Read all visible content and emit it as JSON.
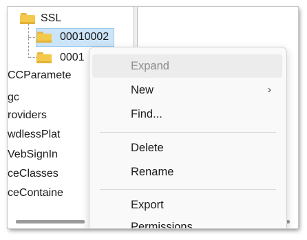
{
  "tree": {
    "items": [
      {
        "label": "SSL"
      },
      {
        "label": "00010002"
      },
      {
        "label": "0001"
      },
      {
        "label": "CCParamete"
      },
      {
        "label": "gc"
      },
      {
        "label": "roviders"
      },
      {
        "label": "wdlessPlat"
      },
      {
        "label": "VebSignIn"
      },
      {
        "label": "ceClasses"
      },
      {
        "label": "ceContaine"
      }
    ]
  },
  "context_menu": {
    "items": [
      {
        "label": "Expand",
        "disabled": true
      },
      {
        "label": "New",
        "submenu_icon": "chevron-right-icon"
      },
      {
        "label": "Find..."
      },
      {
        "label": "Delete"
      },
      {
        "label": "Rename"
      },
      {
        "label": "Export"
      },
      {
        "label": "Permissions..."
      }
    ],
    "submenu_glyph": "›"
  },
  "icons": [
    "folder-icon",
    "chevron-right-icon"
  ],
  "colors": {
    "selection_bg": "#cce4f7",
    "selection_border": "#99c9ef",
    "folder": "#f4c94b",
    "menu_bg": "#f9f9f9",
    "disabled_text": "#8c8c8c"
  }
}
